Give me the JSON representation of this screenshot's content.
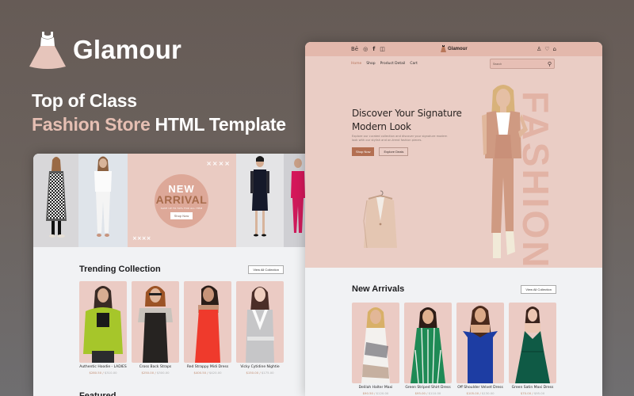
{
  "brand": {
    "name": "Glamour",
    "logo_icon": "dress-icon"
  },
  "tagline": {
    "line1": "Top of Class",
    "line2_accent": "Fashion Store",
    "line2_rest": "HTML Template"
  },
  "colors": {
    "accent": "#e6bfb3",
    "brand_brown": "#b36f52",
    "hero_bg": "#eacdc5",
    "topbar_bg": "#e3b8ac",
    "page_bg": "#f1f2f4"
  },
  "left_preview": {
    "banner": {
      "new": "NEW",
      "arrival": "ARRIVAL",
      "save_text": "SAVE UP TO 50% FOR ALL ITEM",
      "cta": "Shop Now",
      "decor_horizontal": "××××",
      "decor_vertical": "××××"
    },
    "trending": {
      "title": "Trending Collection",
      "view_all": "View All Collection",
      "products": [
        {
          "name": "Authentic Hoodie - LADIES",
          "price": "$280.50",
          "old_price": "$310.00"
        },
        {
          "name": "Cross Back Straps",
          "price": "$250.00",
          "old_price": "$300.00"
        },
        {
          "name": "Red Strappy Midi Dress",
          "price": "$400.50",
          "old_price": "$420.00"
        },
        {
          "name": "Vicky Cytidine Nightie",
          "price": "$150.00",
          "old_price": "$175.00"
        }
      ]
    },
    "next_section_peek": "Featured ..."
  },
  "right_preview": {
    "topbar": {
      "social_icons": [
        "behance-icon",
        "dribbble-icon",
        "facebook-icon",
        "instagram-icon"
      ],
      "brand": "Glamour",
      "user_icons": [
        "user-icon",
        "heart-icon",
        "bag-icon"
      ]
    },
    "nav": {
      "items": [
        {
          "label": "Home",
          "active": true
        },
        {
          "label": "Shop",
          "active": false
        },
        {
          "label": "Product Detail",
          "active": false
        },
        {
          "label": "Cart",
          "active": false
        }
      ],
      "search_placeholder": "Search"
    },
    "hero": {
      "title": "Discover Your Signature Modern Look",
      "description": "Explore our curated collection and discover your signature modern look with our stylish and on-trend fashion pieces.",
      "primary_cta": "Shop Now",
      "secondary_cta": "Explore Deals",
      "watermark": "FASHION"
    },
    "new_arrivals": {
      "title": "New Arrivals",
      "view_all": "View All Collection",
      "products": [
        {
          "name": "Delilah Halter Maxi",
          "price": "$90.50",
          "old_price": "$120.00"
        },
        {
          "name": "Green Striped Shirt Dress",
          "price": "$95.00",
          "old_price": "$110.00"
        },
        {
          "name": "Off Shoulder Velvet Dress",
          "price": "$105.00",
          "old_price": "$130.00"
        },
        {
          "name": "Green Satin Maxi Dress",
          "price": "$70.00",
          "old_price": "$95.00"
        }
      ]
    }
  }
}
